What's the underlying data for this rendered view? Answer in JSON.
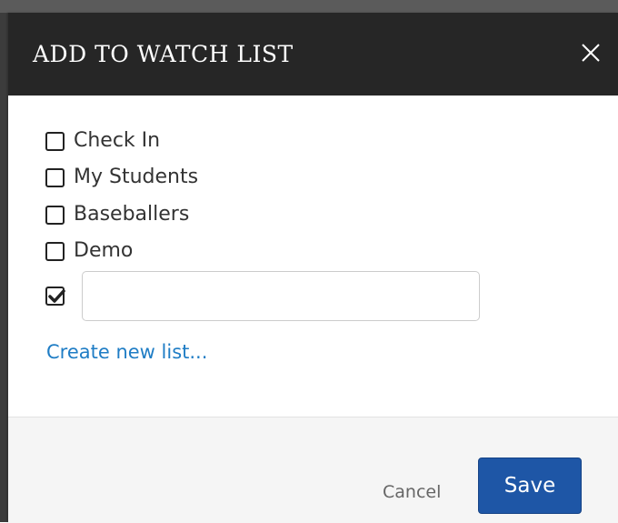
{
  "dialog": {
    "title": "ADD TO WATCH LIST",
    "close_icon": "close-icon"
  },
  "watch_lists": [
    {
      "label": "Check In",
      "checked": false
    },
    {
      "label": "My Students",
      "checked": false
    },
    {
      "label": "Baseballers",
      "checked": false
    },
    {
      "label": "Demo",
      "checked": false
    }
  ],
  "new_list": {
    "checked": true,
    "value": "",
    "placeholder": ""
  },
  "create_link": "Create new list...",
  "footer": {
    "cancel_label": "Cancel",
    "save_label": "Save"
  },
  "colors": {
    "header_bg": "#262626",
    "link": "#1f7dc5",
    "save_bg": "#1e56a6"
  }
}
